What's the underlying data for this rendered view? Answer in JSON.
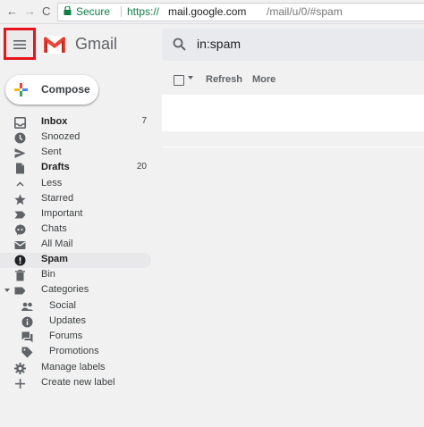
{
  "browser": {
    "back_glyph": "←",
    "forward_glyph": "→",
    "reload_glyph": "C",
    "secure_label": "Secure",
    "url_scheme": "https://",
    "url_host": "mail.google.com",
    "url_path": "/mail/u/0/#spam"
  },
  "header": {
    "app_name": "Gmail",
    "search_value": "in:spam"
  },
  "compose": {
    "label": "Compose"
  },
  "toolbar": {
    "refresh_label": "Refresh",
    "more_label": "More"
  },
  "sidebar": {
    "items": [
      {
        "label": "Inbox",
        "count": "7"
      },
      {
        "label": "Snoozed",
        "count": ""
      },
      {
        "label": "Sent",
        "count": ""
      },
      {
        "label": "Drafts",
        "count": "20"
      },
      {
        "label": "Less",
        "count": ""
      },
      {
        "label": "Starred",
        "count": ""
      },
      {
        "label": "Important",
        "count": ""
      },
      {
        "label": "Chats",
        "count": ""
      },
      {
        "label": "All Mail",
        "count": ""
      },
      {
        "label": "Spam",
        "count": ""
      },
      {
        "label": "Bin",
        "count": ""
      },
      {
        "label": "Categories",
        "count": ""
      },
      {
        "label": "Social",
        "count": ""
      },
      {
        "label": "Updates",
        "count": ""
      },
      {
        "label": "Forums",
        "count": ""
      },
      {
        "label": "Promotions",
        "count": ""
      },
      {
        "label": "Manage labels",
        "count": ""
      },
      {
        "label": "Create new label",
        "count": ""
      }
    ],
    "active_item": "Spam"
  },
  "colors": {
    "highlight_border": "#e8141b",
    "secure_green": "#0b8043",
    "gmail_red": "#ea4335"
  },
  "icons": {
    "main_menu": "hamburger-menu-icon",
    "search": "search-icon",
    "compose": "multicolor-plus-icon"
  }
}
